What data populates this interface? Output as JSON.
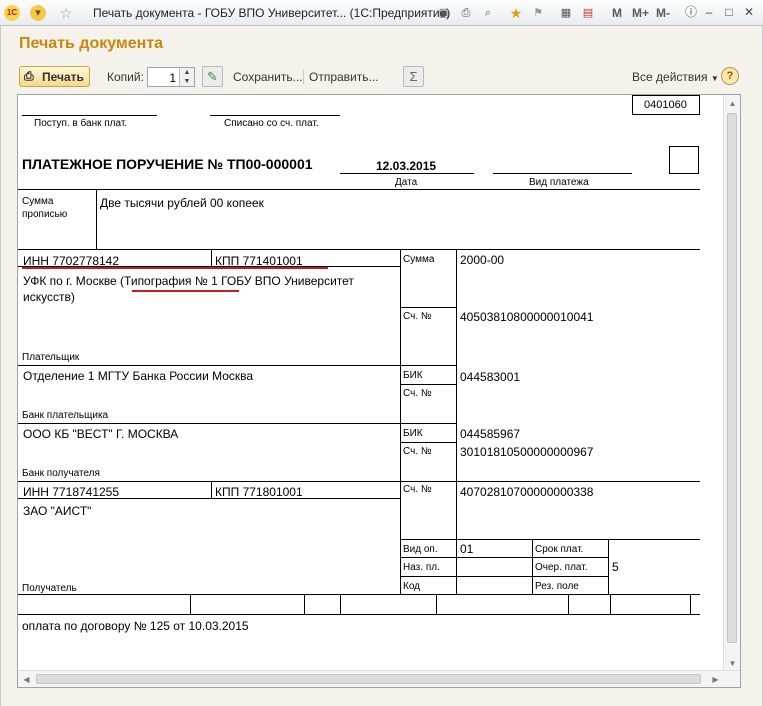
{
  "app": {
    "title": "Печать документа - ГОБУ ВПО Университет... (1С:Предприятие)",
    "logo": "1С",
    "menu_buttons": [
      "M",
      "M+",
      "M-"
    ]
  },
  "page": {
    "title": "Печать документа"
  },
  "toolbar": {
    "print_label": "Печать",
    "copies_label": "Копий:",
    "copies_value": "1",
    "save_label": "Сохранить...",
    "send_label": "Отправить...",
    "all_actions_label": "Все действия",
    "sum_symbol": "Σ",
    "help_symbol": "?"
  },
  "doc": {
    "form_code": "0401060",
    "received_label": "Поступ. в банк плат.",
    "debited_label": "Списано со сч. плат.",
    "title": "ПЛАТЕЖНОЕ ПОРУЧЕНИЕ № ТП00-000001",
    "date_value": "12.03.2015",
    "date_label": "Дата",
    "payment_type_label": "Вид платежа",
    "amount_words_label_1": "Сумма",
    "amount_words_label_2": "прописью",
    "amount_words": "Две тысячи рублей 00 копеек",
    "payer_inn": "ИНН 7702778142",
    "payer_kpp": "КПП 771401001",
    "amount_label": "Сумма",
    "amount_value": "2000-00",
    "payer_name_1": "УФК по г. Москве (Типография № 1 ГОБУ ВПО Университет",
    "payer_name_2": "искусств)",
    "account_label": "Сч. №",
    "payer_account": "40503810800000010041",
    "payer_label": "Плательщик",
    "payer_bank": "Отделение 1 МГТУ Банка России Москва",
    "bik_label": "БИК",
    "payer_bik": "044583001",
    "payer_bank_label": "Банк плательщика",
    "payee_bank": "ООО КБ \"ВЕСТ\" Г. МОСКВА",
    "payee_bik": "044585967",
    "payee_corr_account": "30101810500000000967",
    "payee_bank_label": "Банк получателя",
    "payee_inn": "ИНН 7718741255",
    "payee_kpp": "КПП 771801001",
    "payee_account": "40702810700000000338",
    "payee_name": "ЗАО \"АИСТ\"",
    "op_type_label": "Вид оп.",
    "op_type_value": "01",
    "purpose_code_label": "Наз. пл.",
    "code_label": "Код",
    "due_date_label": "Срок плат.",
    "priority_label": "Очер. плат.",
    "priority_value": "5",
    "reserve_label": "Рез. поле",
    "payee_label": "Получатель",
    "purpose": "оплата по договору № 125 от 10.03.2015"
  },
  "colors": {
    "accent": "#c9880b",
    "underline": "#d11818"
  }
}
